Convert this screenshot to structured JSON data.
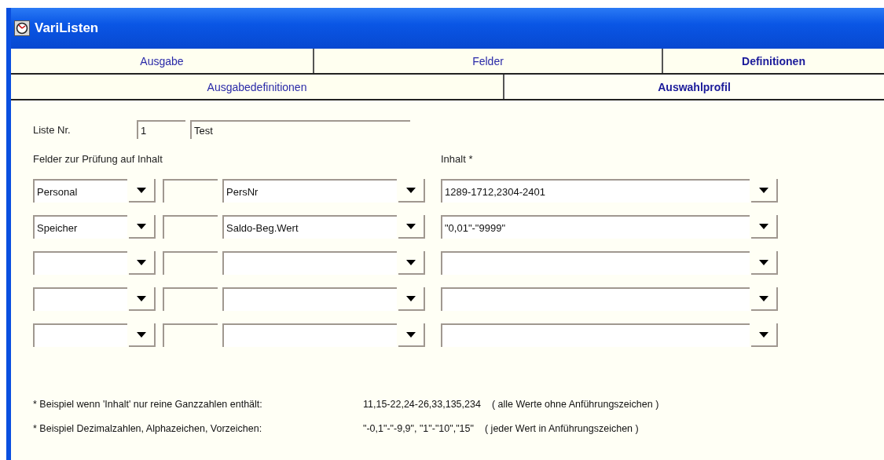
{
  "window": {
    "title": "VariListen"
  },
  "tabs": [
    {
      "label": "Ausgabe",
      "selected": false
    },
    {
      "label": "Felder",
      "selected": false
    },
    {
      "label": "Definitionen",
      "selected": true
    }
  ],
  "subtabs": [
    {
      "label": "Ausgabedefinitionen",
      "selected": false
    },
    {
      "label": "Auswahlprofil",
      "selected": true
    }
  ],
  "list": {
    "label": "Liste Nr.",
    "number": "1",
    "name": "Test"
  },
  "fields_heading": "Felder zur Prüfung auf Inhalt",
  "content_heading": "Inhalt *",
  "rows": [
    {
      "category": "Personal",
      "extra": "",
      "field": "PersNr",
      "content": "1289-1712,2304-2401"
    },
    {
      "category": "Speicher",
      "extra": "",
      "field": "Saldo-Beg.Wert",
      "content": "\"0,01\"-\"9999\""
    },
    {
      "category": "",
      "extra": "",
      "field": "",
      "content": ""
    },
    {
      "category": "",
      "extra": "",
      "field": "",
      "content": ""
    },
    {
      "category": "",
      "extra": "",
      "field": "",
      "content": ""
    }
  ],
  "footnotes": [
    {
      "label": "* Beispiel wenn 'Inhalt' nur reine Ganzzahlen enthält:",
      "example": "11,15-22,24-26,33,135,234",
      "note": "( alle Werte ohne Anführungszeichen )"
    },
    {
      "label": "* Beispiel Dezimalzahlen, Alphazeichen, Vorzeichen:",
      "example": "\"-0,1\"-\"-9,9\", \"1\"-\"10\",\"15\"",
      "note": "( jeder Wert in Anführungszeichen )"
    }
  ]
}
